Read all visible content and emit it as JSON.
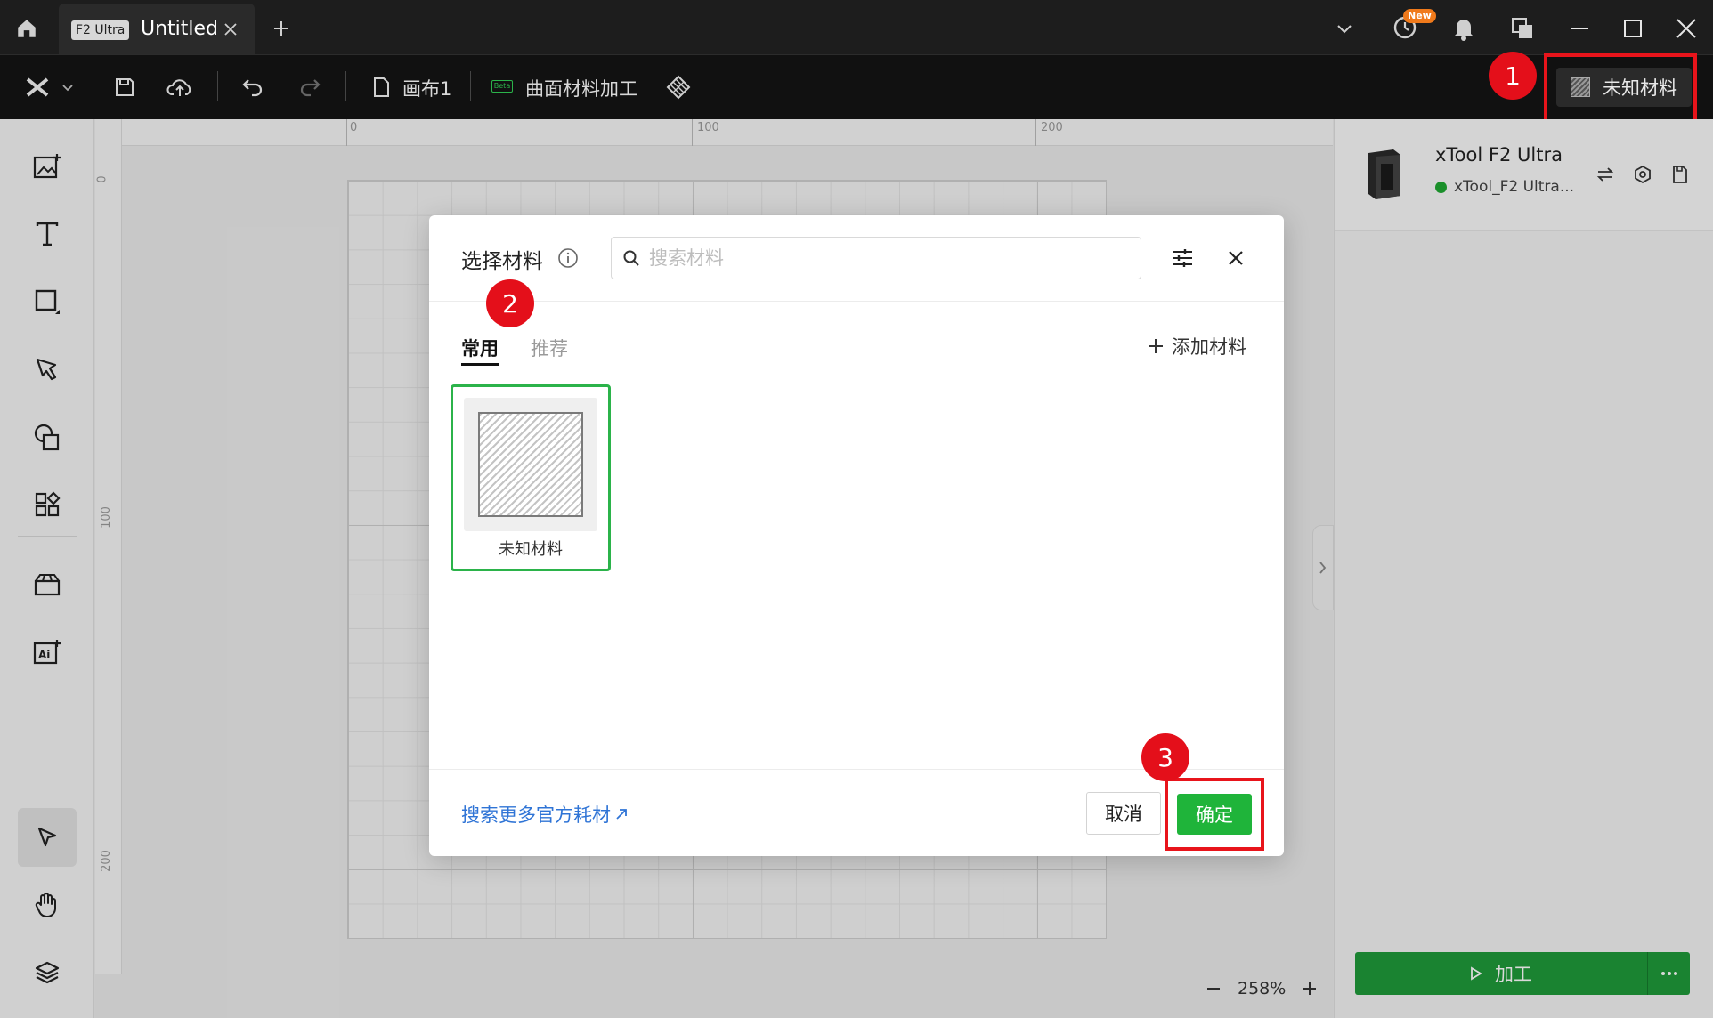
{
  "titlebar": {
    "tab_badge": "F2 Ultra",
    "tab_title": "Untitled",
    "new_badge": "New"
  },
  "toolbar": {
    "canvas_label": "画布1",
    "beta_badge": "Beta",
    "curved_label": "曲面材料加工",
    "material_label": "未知材料"
  },
  "callouts": [
    "1",
    "2",
    "3"
  ],
  "rulers": {
    "top": [
      "0",
      "100",
      "200"
    ],
    "left": [
      "0",
      "100",
      "200"
    ]
  },
  "zoom": {
    "level": "258%"
  },
  "device": {
    "name": "xTool F2 Ultra",
    "status": "xTool_F2 Ultra..."
  },
  "process": {
    "label": "加工"
  },
  "modal": {
    "title": "选择材料",
    "search_placeholder": "搜索材料",
    "tabs": {
      "common": "常用",
      "recommend": "推荐"
    },
    "add_material": "添加材料",
    "material_card": "未知材料",
    "more_link": "搜索更多官方耗材",
    "cancel": "取消",
    "confirm": "确定"
  },
  "colors": {
    "accent_green": "#1fb43a",
    "highlight_red": "#e8141b",
    "link_blue": "#2f74d6"
  }
}
